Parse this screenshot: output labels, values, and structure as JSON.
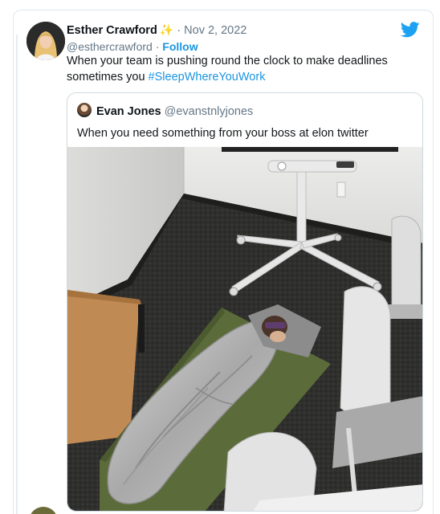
{
  "tweet": {
    "author_name": "Esther Crawford",
    "verified_emoji": "✨",
    "date_separator": "·",
    "date": "Nov 2, 2022",
    "handle": "@esthercrawford",
    "handle_separator": "·",
    "follow_label": "Follow",
    "text": "When your team is pushing round the clock to make deadlines sometimes you",
    "hashtag": "#SleepWhereYouWork",
    "icons": {
      "avatar": "avatar-photo",
      "brand": "twitter-bird-icon"
    },
    "colors": {
      "link": "#1b95e0",
      "brand": "#1da1f2",
      "muted": "#657786"
    }
  },
  "quoted_tweet": {
    "author_name": "Evan Jones",
    "handle": "@evanstnlyjones",
    "text": "When you need something from your boss at elon twitter",
    "media": "photo-person-sleeping-on-office-floor"
  }
}
